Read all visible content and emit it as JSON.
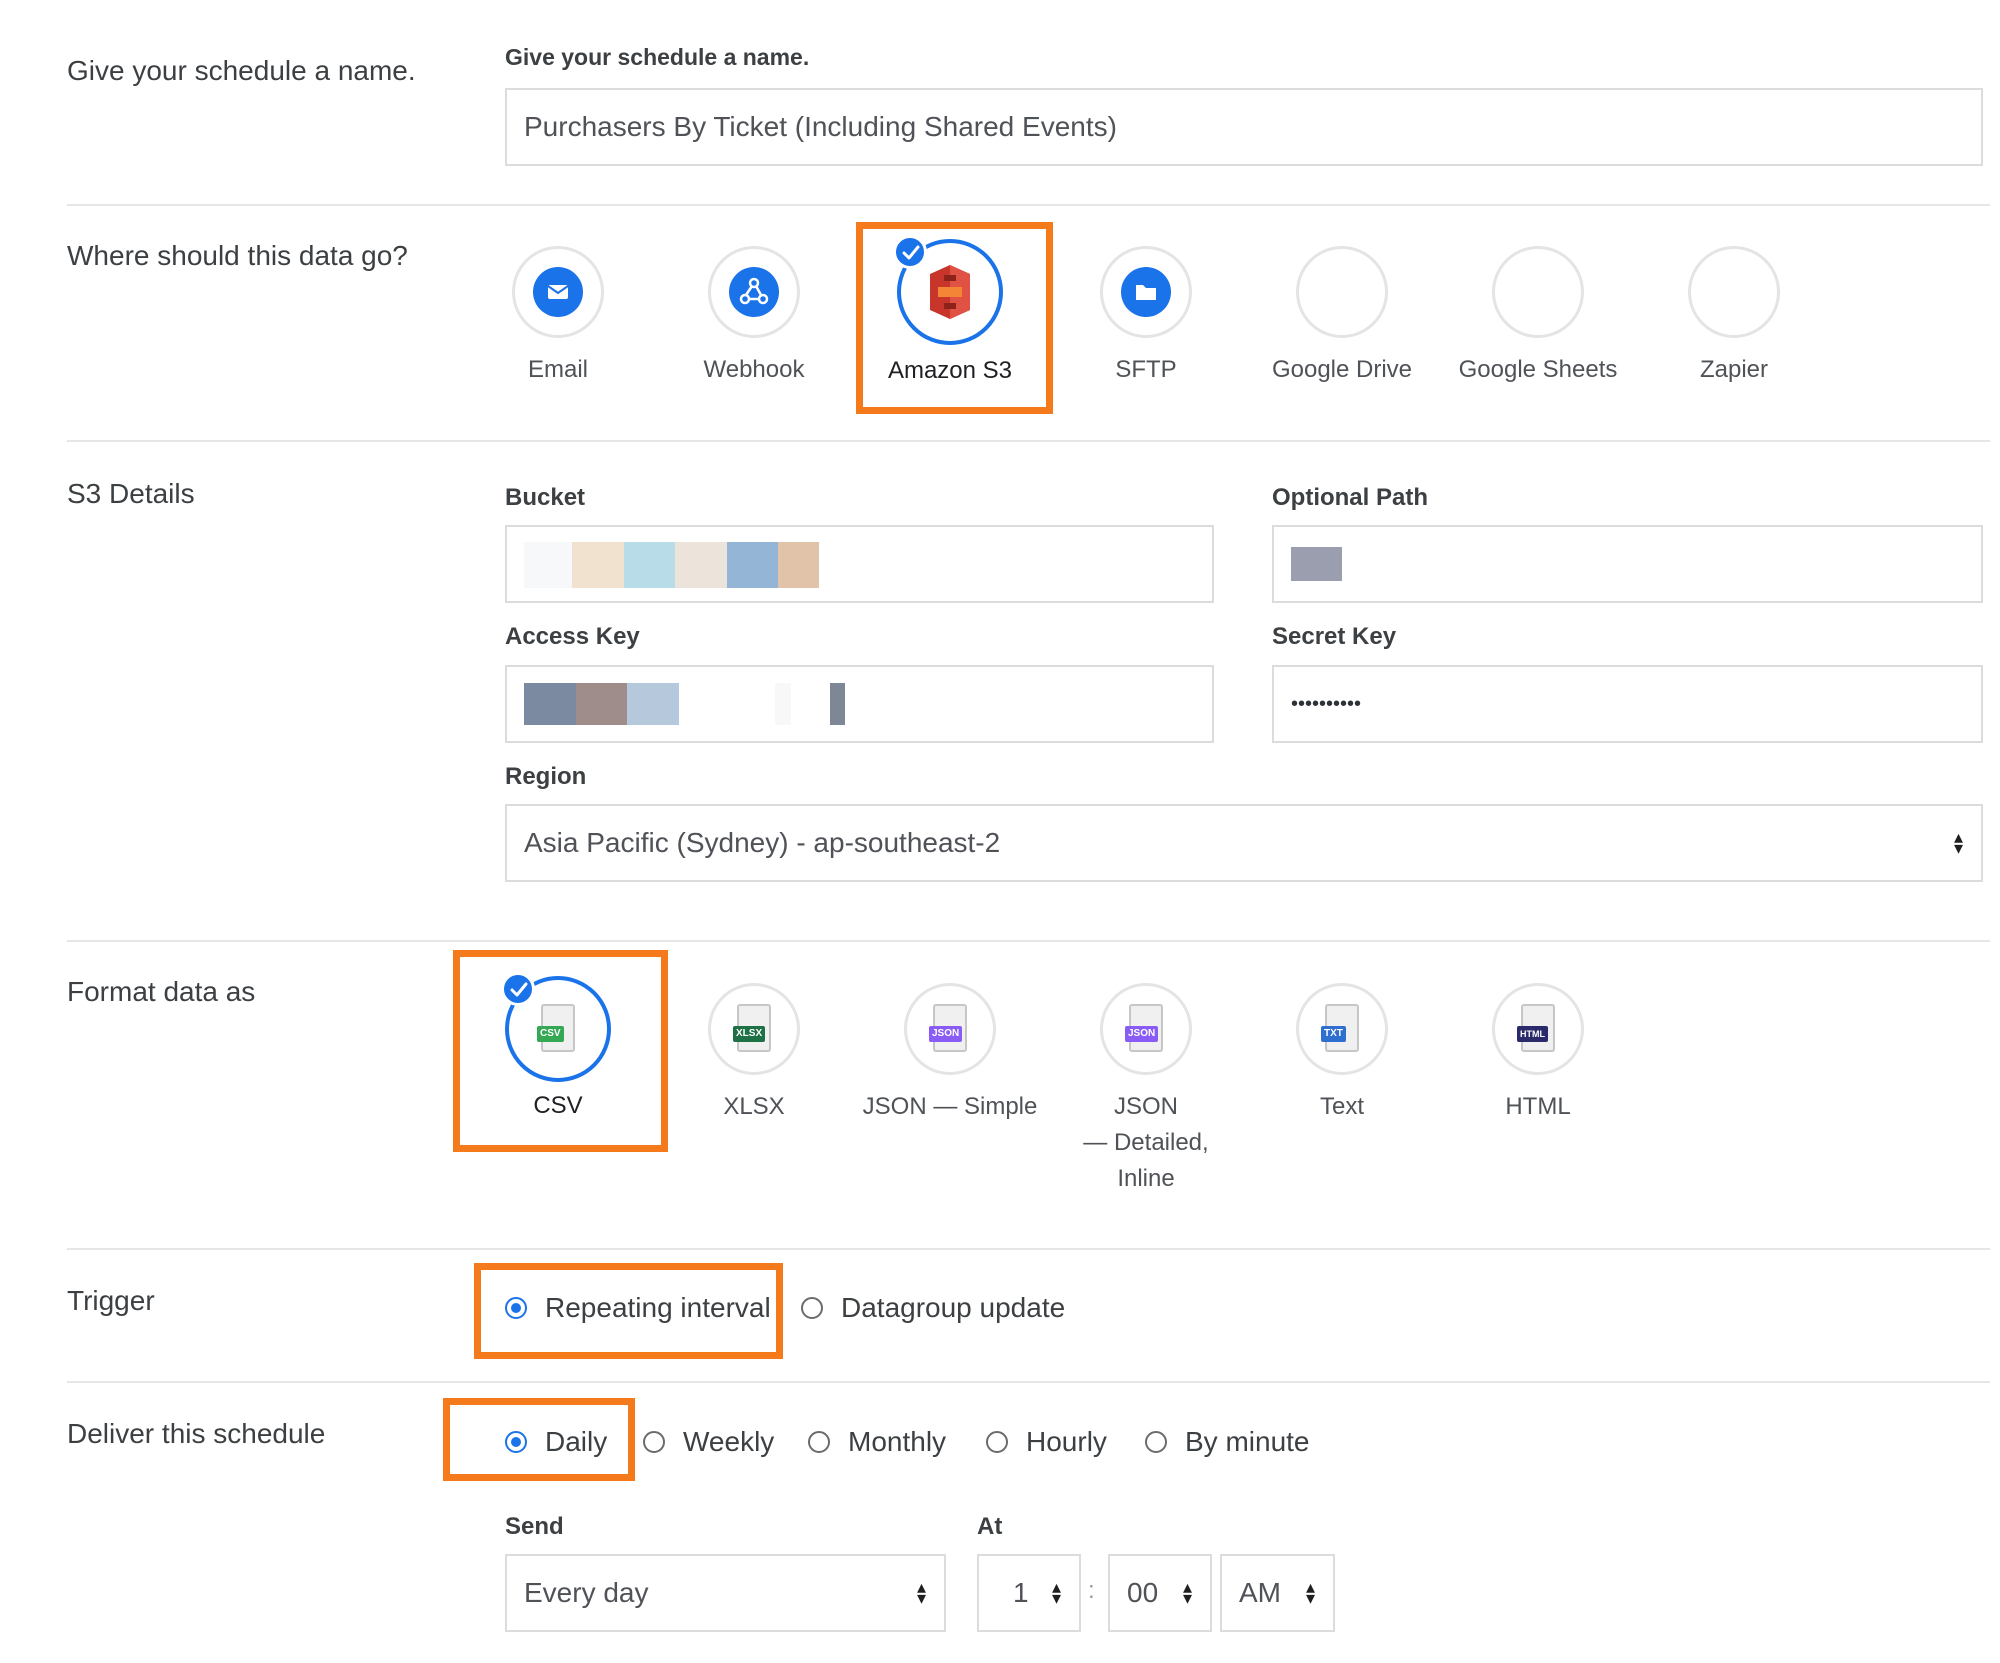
{
  "name_section": {
    "label": "Give your schedule a name.",
    "field_label": "Give your schedule a name.",
    "value": "Purchasers By Ticket (Including Shared Events)"
  },
  "destination_section": {
    "label": "Where should this data go?",
    "options": [
      {
        "label": "Email",
        "icon": "email-icon",
        "selected": false
      },
      {
        "label": "Webhook",
        "icon": "webhook-icon",
        "selected": false
      },
      {
        "label": "Amazon S3",
        "icon": "amazon-s3-icon",
        "selected": true
      },
      {
        "label": "SFTP",
        "icon": "sftp-icon",
        "selected": false
      },
      {
        "label": "Google Drive",
        "icon": "google-drive-icon",
        "selected": false
      },
      {
        "label": "Google Sheets",
        "icon": "google-sheets-icon",
        "selected": false
      },
      {
        "label": "Zapier",
        "icon": "zapier-icon",
        "selected": false
      }
    ]
  },
  "s3_section": {
    "label": "S3 Details",
    "bucket_label": "Bucket",
    "optional_path_label": "Optional Path",
    "access_key_label": "Access Key",
    "secret_key_label": "Secret Key",
    "secret_key_value": "••••••••••",
    "region_label": "Region",
    "region_value": "Asia Pacific (Sydney) - ap-southeast-2"
  },
  "format_section": {
    "label": "Format data as",
    "options": [
      {
        "label": "CSV",
        "tag": "CSV",
        "tag_color": "#34a853",
        "selected": true
      },
      {
        "label": "XLSX",
        "tag": "XLSX",
        "tag_color": "#1e7145",
        "selected": false
      },
      {
        "label": "JSON — Simple",
        "tag": "JSON",
        "tag_color": "#8a5cf6",
        "selected": false
      },
      {
        "label_lines": [
          "JSON",
          "— Detailed,",
          "Inline"
        ],
        "tag": "JSON",
        "tag_color": "#8a5cf6",
        "selected": false
      },
      {
        "label": "Text",
        "tag": "TXT",
        "tag_color": "#2f6fd0",
        "selected": false
      },
      {
        "label": "HTML",
        "tag": "HTML",
        "tag_color": "#2b2b6b",
        "selected": false
      }
    ]
  },
  "trigger_section": {
    "label": "Trigger",
    "options": [
      {
        "label": "Repeating interval",
        "selected": true
      },
      {
        "label": "Datagroup update",
        "selected": false
      }
    ]
  },
  "deliver_section": {
    "label": "Deliver this schedule",
    "options": [
      {
        "label": "Daily",
        "selected": true
      },
      {
        "label": "Weekly",
        "selected": false
      },
      {
        "label": "Monthly",
        "selected": false
      },
      {
        "label": "Hourly",
        "selected": false
      },
      {
        "label": "By minute",
        "selected": false
      }
    ],
    "send_label": "Send",
    "send_value": "Every day",
    "at_label": "At",
    "hour_value": "1",
    "time_separator": ":",
    "minute_value": "00",
    "ampm_value": "AM"
  },
  "colors": {
    "accent": "#1a73e8",
    "highlight": "#f47a1c"
  }
}
